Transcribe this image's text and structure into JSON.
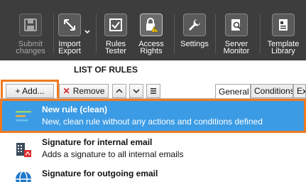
{
  "ribbon": {
    "buttons": [
      {
        "name": "submit-changes",
        "label": "Submit\nchanges",
        "icon": "save-icon",
        "disabled": true
      },
      {
        "name": "import-export",
        "label": "Import\nExport",
        "icon": "import-export-icon",
        "disabled": false
      },
      {
        "name": "rules-tester",
        "label": "Rules\nTester",
        "icon": "checkbox-icon",
        "disabled": false
      },
      {
        "name": "access-rights",
        "label": "Access\nRights",
        "icon": "lock-warning-icon",
        "disabled": false
      },
      {
        "name": "settings",
        "label": "Settings",
        "icon": "wrench-icon",
        "disabled": false
      },
      {
        "name": "server-monitor",
        "label": "Server\nMonitor",
        "icon": "monitor-search-icon",
        "disabled": false
      },
      {
        "name": "template-library",
        "label": "Template\nLibrary",
        "icon": "library-icon",
        "disabled": false
      }
    ]
  },
  "list": {
    "title": "LIST OF RULES"
  },
  "toolbar": {
    "add_label": "+ Add...",
    "remove_label": "Remove",
    "up_icon": "chevron-up-icon",
    "down_icon": "chevron-down-icon",
    "menu_icon": "menu-icon"
  },
  "tabs": [
    {
      "label": "General",
      "active": true
    },
    {
      "label": "Conditions",
      "active": false
    },
    {
      "label": "Ex",
      "active": false
    }
  ],
  "rules": [
    {
      "title": "New rule (clean)",
      "description": "New, clean rule without any actions and conditions defined",
      "icon": "new-rule-icon",
      "selected": true
    },
    {
      "title": "Signature for internal email",
      "description": "Adds a signature to all internal emails",
      "icon": "building-signature-icon",
      "selected": false
    },
    {
      "title": "Signature for outgoing email",
      "description": "",
      "icon": "globe-icon",
      "selected": false
    }
  ],
  "colors": {
    "ribbon_bg": "#3d3d3d",
    "selection": "#3b9be5",
    "highlight": "#f07a20",
    "remove_x": "#d42020"
  }
}
